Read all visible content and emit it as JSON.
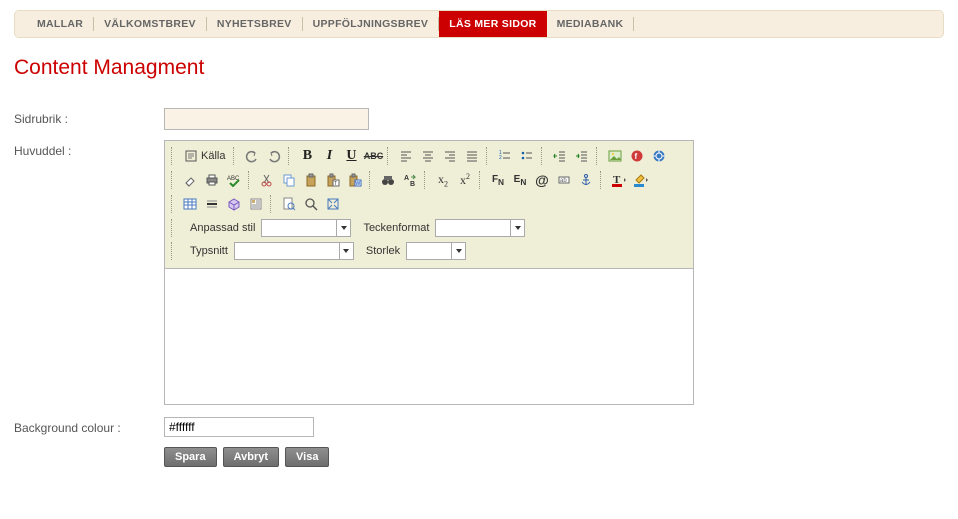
{
  "tabs": {
    "items": [
      {
        "label": "MALLAR",
        "active": false
      },
      {
        "label": "VÄLKOMSTBREV",
        "active": false
      },
      {
        "label": "NYHETSBREV",
        "active": false
      },
      {
        "label": "UPPFÖLJNINGSBREV",
        "active": false
      },
      {
        "label": "LÄS MER SIDOR",
        "active": true
      },
      {
        "label": "MEDIABANK",
        "active": false
      }
    ]
  },
  "page_title": "Content Managment",
  "form": {
    "sidrubrik_label": "Sidrubrik :",
    "sidrubrik_value": "",
    "huvuddel_label": "Huvuddel :",
    "bgcolor_label": "Background colour :",
    "bgcolor_value": "#ffffff"
  },
  "editor": {
    "source_label": "Källa",
    "combo_style_label": "Anpassad stil",
    "combo_style_value": "",
    "combo_format_label": "Teckenformat",
    "combo_format_value": "",
    "combo_font_label": "Typsnitt",
    "combo_font_value": "",
    "combo_size_label": "Storlek",
    "combo_size_value": "",
    "content": ""
  },
  "buttons": {
    "save": "Spara",
    "cancel": "Avbryt",
    "show": "Visa"
  }
}
